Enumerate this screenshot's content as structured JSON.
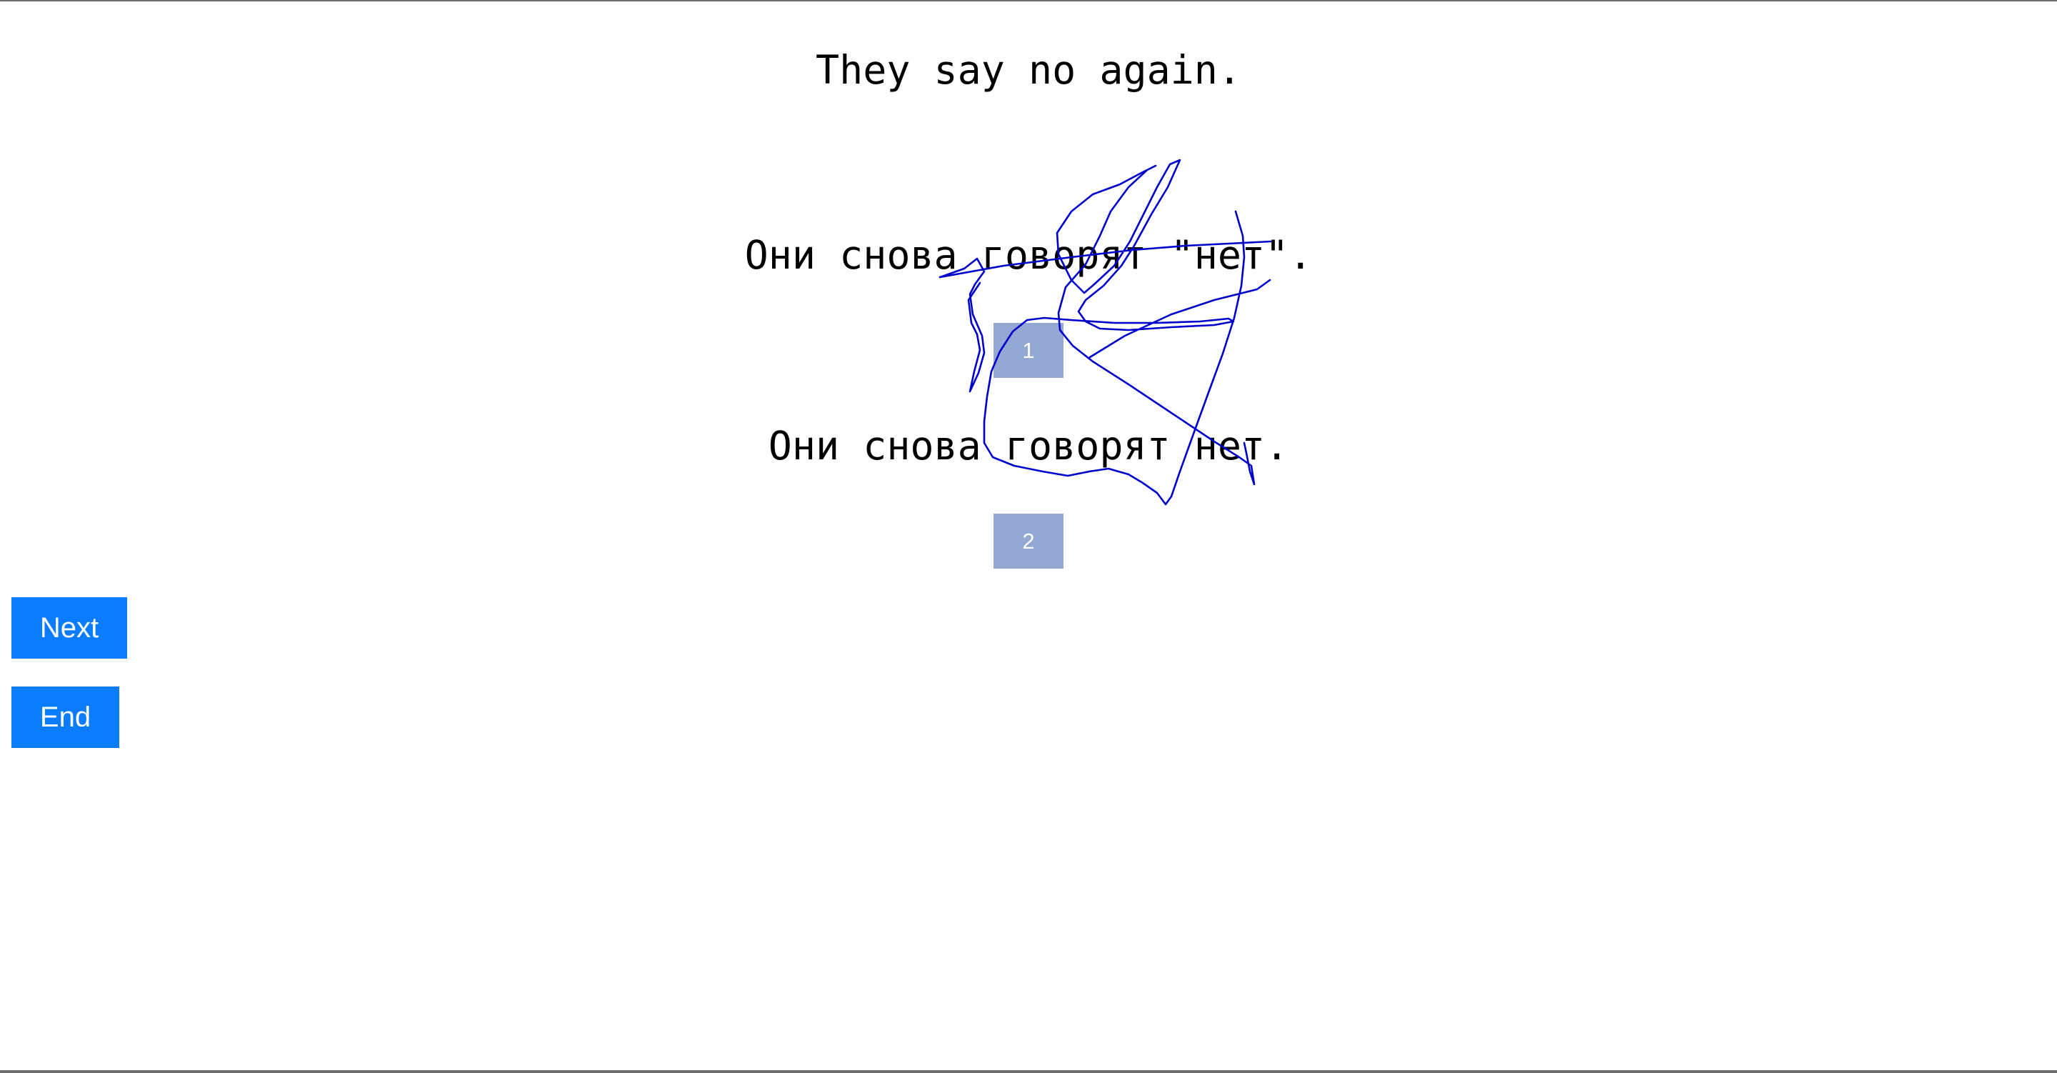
{
  "prompt": {
    "text": "They say no again."
  },
  "options": [
    {
      "text": "Они снова говорят \"нет\".",
      "button_label": "1"
    },
    {
      "text": "Они снова говорят нет.",
      "button_label": "2"
    }
  ],
  "actions": {
    "next_label": "Next",
    "end_label": "End"
  },
  "colors": {
    "option_button": "#94a8d4",
    "action_button": "#0a7cff",
    "scribble": "#0000cc"
  }
}
